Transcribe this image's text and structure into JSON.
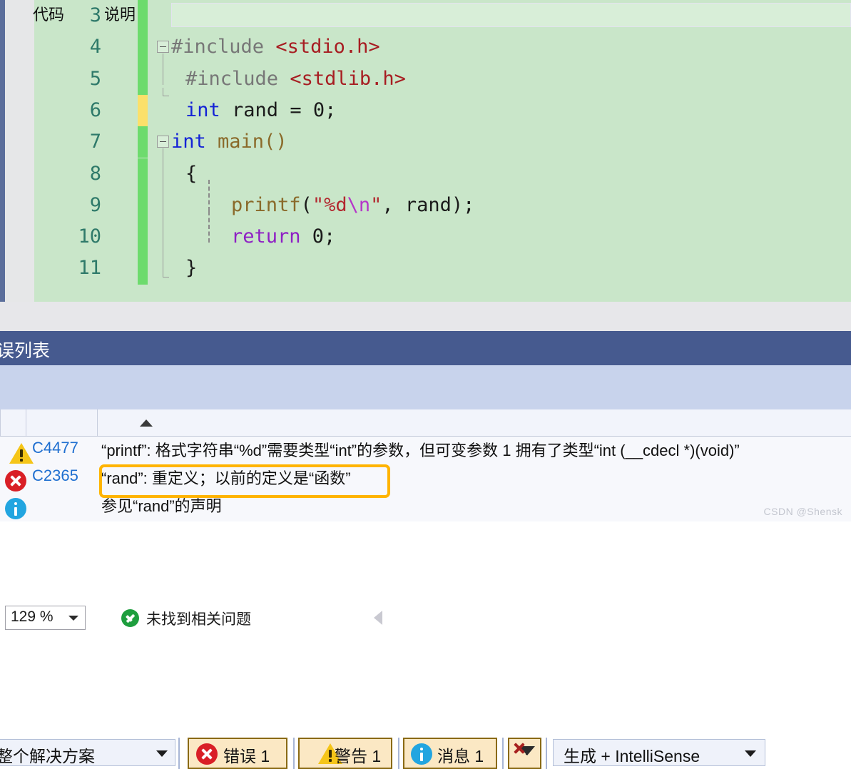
{
  "editor": {
    "zoom_level": "129 %",
    "lines": [
      {
        "num": "3",
        "change": "none",
        "text": ""
      },
      {
        "num": "4",
        "change": "added",
        "text": "#include <stdio.h>"
      },
      {
        "num": "5",
        "change": "added",
        "text": "  #include <stdlib.h>"
      },
      {
        "num": "6",
        "change": "modified",
        "text": "  int rand = 0;"
      },
      {
        "num": "7",
        "change": "added",
        "text": "int main()"
      },
      {
        "num": "8",
        "change": "added",
        "text": "  {"
      },
      {
        "num": "9",
        "change": "added",
        "text": "      printf(\"%d\\n\", rand);"
      },
      {
        "num": "10",
        "change": "added",
        "text": "      return 0;"
      },
      {
        "num": "11",
        "change": "added",
        "text": "  }"
      }
    ],
    "tokens": {
      "include_1": "#include",
      "header_1": "<stdio.h>",
      "include_2": "#include",
      "header_2": "<stdlib.h>",
      "kw_int_1": "int",
      "ident_rand_decl": " rand = 0;",
      "kw_int_2": "int",
      "ident_main": " main()",
      "brace_open": "{",
      "fn_printf": "printf",
      "paren_open": "(",
      "str_open": "\"%d",
      "str_esc": "\\n",
      "str_close": "\"",
      "args_rest": ", rand);",
      "kw_return": "return",
      "return_val": " 0;",
      "brace_close": "}"
    }
  },
  "editor_status": {
    "ok_text": "未找到相关问题",
    "collapse_icon": "triangle-left-icon",
    "ok_icon": "check-circle-icon"
  },
  "error_panel": {
    "title": "错误列表",
    "scope_selected": "整个解决方案",
    "build_scope_selected": "生成 + IntelliSense",
    "filters": [
      {
        "id": "errors",
        "icon": "error-icon",
        "label": "错误 1",
        "active": true
      },
      {
        "id": "warnings",
        "icon": "warning-icon",
        "label": "警告 1",
        "active": true
      },
      {
        "id": "messages",
        "icon": "info-icon",
        "label": "消息 1",
        "active": true
      }
    ],
    "clear_filter_icon": "clear-filter-icon",
    "columns": [
      {
        "key": "severity",
        "label": ""
      },
      {
        "key": "code",
        "label": "代码"
      },
      {
        "key": "desc",
        "label": "说明",
        "sort": "ascending"
      }
    ],
    "rows": [
      {
        "severity": "warning-icon",
        "code": "C4477",
        "desc": "“printf”: 格式字符串“%d”需要类型“int”的参数，但可变参数 1 拥有了类型“int (__cdecl *)(void)”",
        "highlighted": false
      },
      {
        "severity": "error-icon",
        "code": "C2365",
        "desc": "“rand”: 重定义；以前的定义是“函数”",
        "highlighted": true
      },
      {
        "severity": "info-icon",
        "code": "",
        "desc": "参见“rand”的声明",
        "highlighted": false
      }
    ]
  },
  "watermark": "CSDN @Shensk",
  "colors": {
    "editor_bg": "#c9e6c9",
    "change_added": "#6ddb6d",
    "change_modified": "#fbe06a",
    "panel_title_bg": "#465a8f",
    "toolbar_bg": "#c8d3ec",
    "highlight_border": "#ffb400",
    "error_red": "#d91f26",
    "warning_yellow": "#f5c518",
    "info_blue": "#22a5e0"
  }
}
